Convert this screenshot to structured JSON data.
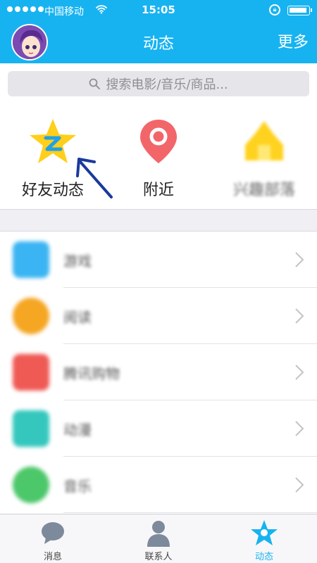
{
  "status_bar": {
    "carrier": "中国移动",
    "time": "15:05"
  },
  "nav": {
    "title": "动态",
    "more": "更多"
  },
  "search": {
    "placeholder": "搜索电影/音乐/商品..."
  },
  "shortcuts": [
    {
      "label": "好友动态",
      "icon": "qzone-star-icon",
      "color": "#ffcf1a"
    },
    {
      "label": "附近",
      "icon": "location-pin-icon",
      "color": "#f2666a"
    },
    {
      "label": "兴趣部落",
      "icon": "tribe-icon",
      "color": "#ffd21f"
    }
  ],
  "list": [
    {
      "label": "游戏",
      "icon": "game-icon",
      "color": "#3ab4f2"
    },
    {
      "label": "阅读",
      "icon": "reading-icon",
      "color": "#f5a623"
    },
    {
      "label": "腾讯购物",
      "icon": "shopping-icon",
      "color": "#ef5a55"
    },
    {
      "label": "动漫",
      "icon": "comic-icon",
      "color": "#35c7bd"
    },
    {
      "label": "音乐",
      "icon": "music-icon",
      "color": "#4cc76a"
    }
  ],
  "tabbar": [
    {
      "label": "消息",
      "icon": "message-icon",
      "active": false
    },
    {
      "label": "联系人",
      "icon": "contacts-icon",
      "active": false
    },
    {
      "label": "动态",
      "icon": "discover-star-icon",
      "active": true
    }
  ],
  "accent_color": "#17b3f1"
}
